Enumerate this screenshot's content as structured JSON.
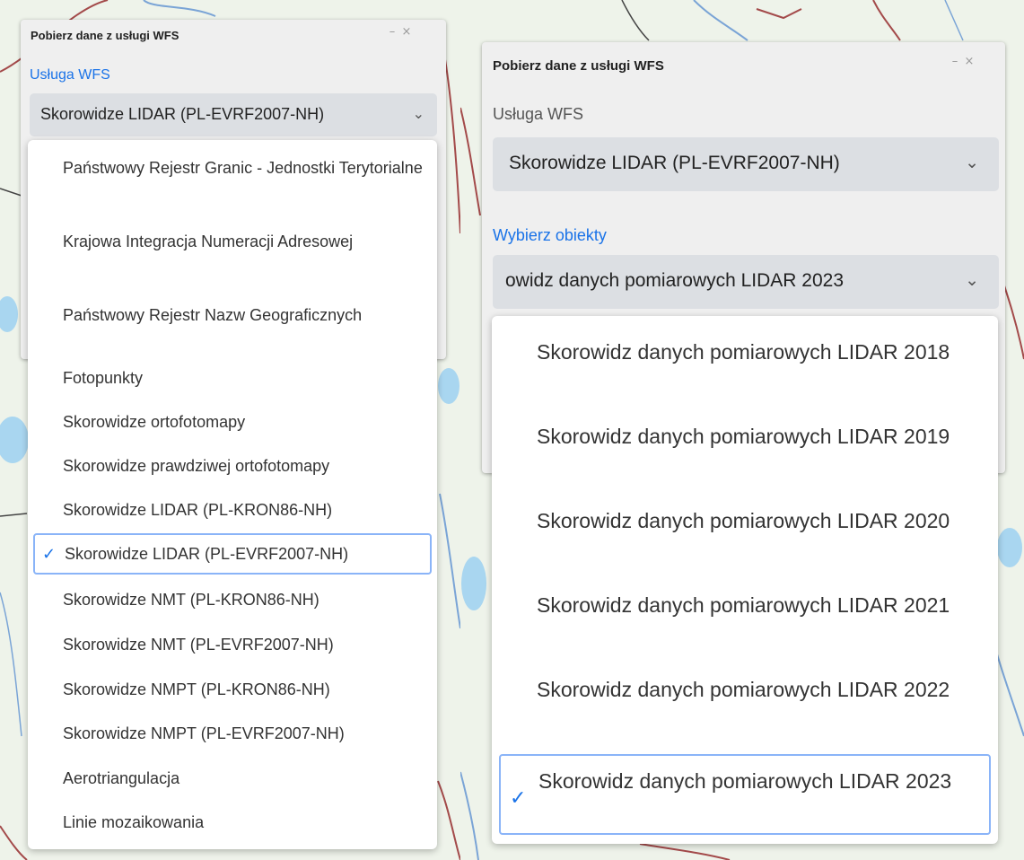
{
  "left_window": {
    "title": "Pobierz dane z usługi WFS",
    "minimize_symbol": "–",
    "close_symbol": "×",
    "service_label": "Usługa WFS",
    "service_selected": "Skorowidze LIDAR (PL-EVRF2007-NH)",
    "chevron_symbol": "⌄",
    "options": [
      {
        "label": "Państwowy Rejestr Granic - Jednostki Terytorialne",
        "selected": false
      },
      {
        "label": "Krajowa Integracja Numeracji Adresowej",
        "selected": false
      },
      {
        "label": "Państwowy Rejestr Nazw Geograficznych",
        "selected": false
      },
      {
        "label": "Fotopunkty",
        "selected": false
      },
      {
        "label": "Skorowidze ortofotomapy",
        "selected": false
      },
      {
        "label": "Skorowidze prawdziwej ortofotomapy",
        "selected": false
      },
      {
        "label": "Skorowidze LIDAR (PL-KRON86-NH)",
        "selected": false
      },
      {
        "label": "Skorowidze LIDAR (PL-EVRF2007-NH)",
        "selected": true
      },
      {
        "label": "Skorowidze NMT (PL-KRON86-NH)",
        "selected": false
      },
      {
        "label": "Skorowidze NMT (PL-EVRF2007-NH)",
        "selected": false
      },
      {
        "label": "Skorowidze NMPT (PL-KRON86-NH)",
        "selected": false
      },
      {
        "label": "Skorowidze NMPT (PL-EVRF2007-NH)",
        "selected": false
      },
      {
        "label": "Aerotriangulacja",
        "selected": false
      },
      {
        "label": "Linie mozaikowania",
        "selected": false
      }
    ]
  },
  "right_window": {
    "title": "Pobierz dane z usługi WFS",
    "minimize_symbol": "–",
    "close_symbol": "×",
    "service_label": "Usługa WFS",
    "service_selected": "Skorowidze LIDAR (PL-EVRF2007-NH)",
    "objects_label": "Wybierz obiekty",
    "objects_selected_visible": "owidz danych pomiarowych LIDAR 2023",
    "chevron_symbol": "⌄",
    "options": [
      {
        "label": "Skorowidz danych pomiarowych LIDAR 2018",
        "selected": false
      },
      {
        "label": "Skorowidz danych pomiarowych LIDAR 2019",
        "selected": false
      },
      {
        "label": "Skorowidz danych pomiarowych LIDAR 2020",
        "selected": false
      },
      {
        "label": "Skorowidz danych pomiarowych LIDAR 2021",
        "selected": false
      },
      {
        "label": "Skorowidz danych pomiarowych LIDAR 2022",
        "selected": false
      },
      {
        "label": "Skorowidz danych pomiarowych LIDAR 2023",
        "selected": true
      }
    ]
  },
  "check_symbol": "✓",
  "colors": {
    "accent": "#1a73e8",
    "selected_border": "#8ab4f8",
    "select_bg": "#dcdfe3",
    "panel_bg": "#efefef",
    "map_bg": "#eef3ea"
  }
}
